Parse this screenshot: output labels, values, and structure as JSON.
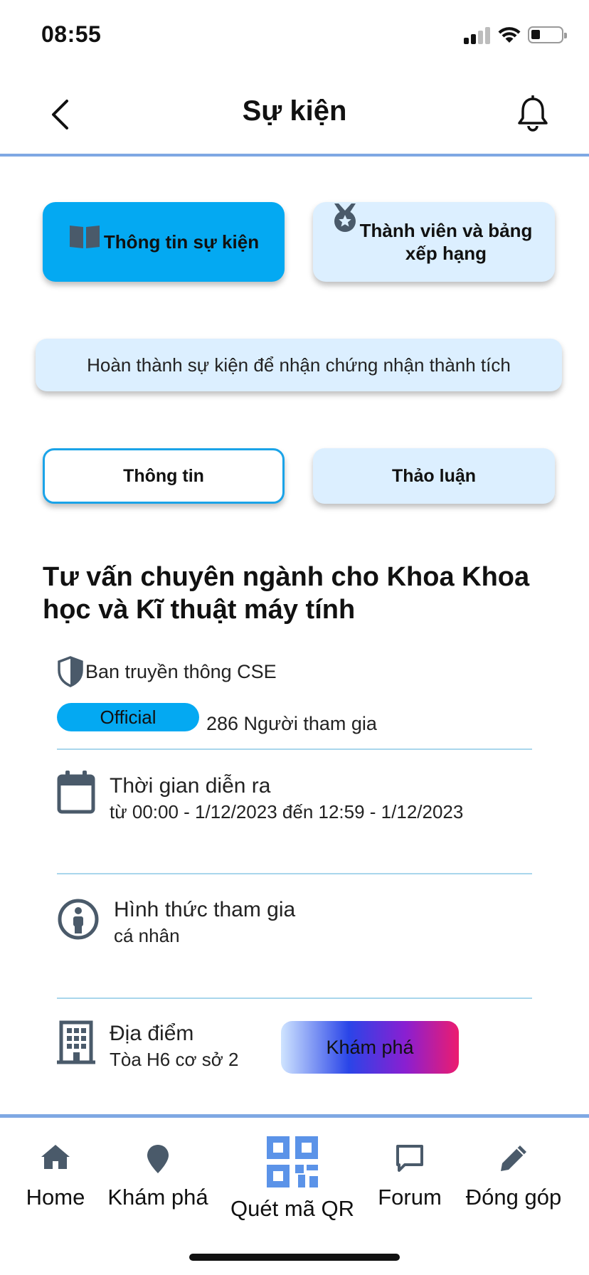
{
  "status_bar": {
    "time": "08:55"
  },
  "header": {
    "title": "Sự kiện"
  },
  "tabs": {
    "event_info": "Thông tin sự kiện",
    "members_ranking": "Thành viên và bảng xếp hạng"
  },
  "banner": {
    "text": "Hoàn thành sự kiện để nhận chứng nhận thành tích"
  },
  "subtabs": {
    "info": "Thông tin",
    "discussion": "Thảo luận"
  },
  "event": {
    "title": "Tư vấn chuyên ngành cho Khoa Khoa học và Kĩ thuật máy tính",
    "organizer": "Ban truyền thông CSE",
    "badge": "Official",
    "participants": "286 Người tham gia",
    "time_label": "Thời gian diễn ra",
    "time_value": "từ 00:00 - 1/12/2023 đến 12:59 - 1/12/2023",
    "participation_label": "Hình thức tham gia",
    "participation_value": "cá nhân",
    "location_label": "Địa điểm",
    "location_value": "Tòa H6 cơ sở 2",
    "explore_button": "Khám phá"
  },
  "colors": {
    "accent_blue": "#04a9f2",
    "light_blue": "#dcefff",
    "header_line": "#7fa8e3",
    "icon_gray": "#4a5a6a"
  },
  "bottom_nav": {
    "home": "Home",
    "explore": "Khám phá",
    "qr": "Quét mã QR",
    "forum": "Forum",
    "contribute": "Đóng góp"
  }
}
